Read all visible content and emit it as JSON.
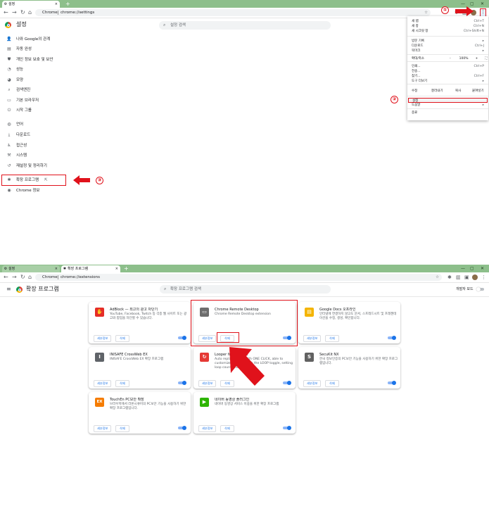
{
  "colors": {
    "tab_strip": "#8dbf8b",
    "accent": "#1a73e8",
    "highlight": "#e0121b"
  },
  "settings_window": {
    "tab_title": "설정",
    "address": {
      "label": "Chrome",
      "url": "chrome://settings"
    },
    "page_title": "설정",
    "search_placeholder": "설정 검색",
    "sidebar": [
      {
        "label": "나와 Google의 관계",
        "icon": "person-icon"
      },
      {
        "label": "자동 완성",
        "icon": "clipboard-icon"
      },
      {
        "label": "개인 정보 보호 및 보안",
        "icon": "shield-icon"
      },
      {
        "label": "성능",
        "icon": "speedometer-icon"
      },
      {
        "label": "모양",
        "icon": "palette-icon"
      },
      {
        "label": "검색엔진",
        "icon": "search-icon"
      },
      {
        "label": "기본 브라우저",
        "icon": "browser-icon"
      },
      {
        "label": "시작 그룹",
        "icon": "power-icon"
      },
      {
        "label": "언어",
        "icon": "globe-icon"
      },
      {
        "label": "다운로드",
        "icon": "download-icon"
      },
      {
        "label": "접근성",
        "icon": "accessibility-icon"
      },
      {
        "label": "시스템",
        "icon": "wrench-icon"
      },
      {
        "label": "재설정 및 정리하기",
        "icon": "reset-icon"
      },
      {
        "label": "확장 프로그램",
        "icon": "puzzle-icon"
      },
      {
        "label": "Chrome 정보",
        "icon": "chrome-icon"
      }
    ],
    "annotations": {
      "step1": "①",
      "step2": "②",
      "step3": "③"
    }
  },
  "menu": {
    "items": [
      {
        "label": "새 탭",
        "shortcut": "Ctrl+T"
      },
      {
        "label": "새 창",
        "shortcut": "Ctrl+N"
      },
      {
        "label": "새 시크릿 창",
        "shortcut": "Ctrl+Shift+N"
      },
      {
        "label": "방문 기록",
        "shortcut": "▸"
      },
      {
        "label": "다운로드",
        "shortcut": "Ctrl+J"
      },
      {
        "label": "북마크",
        "shortcut": "▸"
      },
      {
        "label": "확대/축소",
        "shortcut": ""
      },
      {
        "label": "인쇄...",
        "shortcut": "Ctrl+P"
      },
      {
        "label": "전송...",
        "shortcut": ""
      },
      {
        "label": "찾기...",
        "shortcut": "Ctrl+F"
      },
      {
        "label": "도구 더보기",
        "shortcut": "▸"
      },
      {
        "label": "설정",
        "shortcut": ""
      },
      {
        "label": "도움말",
        "shortcut": "▸"
      },
      {
        "label": "종료",
        "shortcut": ""
      }
    ],
    "zoom": {
      "minus": "-",
      "value": "100%",
      "plus": "+"
    },
    "edit": {
      "label": "수정",
      "cut": "잘라내기",
      "copy": "복사",
      "paste": "붙여넣기"
    }
  },
  "ext_window": {
    "tabs": [
      "설정",
      "확장 프로그램"
    ],
    "address": {
      "label": "Chrome",
      "url": "chrome://extensions"
    },
    "page_title": "확장 프로그램",
    "search_placeholder": "확장 프로그램 검색",
    "dev_mode_label": "개발자 모드",
    "details_label": "세부정보",
    "remove_label": "삭제",
    "cards": [
      {
        "name": "AdBlock — 최고의 광고 차단기",
        "desc": "YouTube, Facebook, Twitch 등 각종 웹 사이트 또는 광고와 팝업을 차단할 수 있습니다.",
        "icon": "adblock-icon",
        "color": "#e52d27",
        "glyph": "✋"
      },
      {
        "name": "Chrome Remote Desktop",
        "desc": "Chrome Remote Desktop extension",
        "icon": "remote-desktop-icon",
        "color": "#6d6d6d",
        "glyph": "▭"
      },
      {
        "name": "Google Docs 오프라인",
        "desc": "인터넷에 연결하지 않고도 문서, 스프레드시트 및 프레젠테이션을 수정, 생성, 확인합니다.",
        "icon": "google-docs-icon",
        "color": "#f4b400",
        "glyph": "▤"
      },
      {
        "name": "INISAFE CrossWeb EX",
        "desc": "INISAFE CrossWeb EX 확장 프로그램",
        "icon": "inisafe-icon",
        "color": "#5f6368",
        "glyph": "I"
      },
      {
        "name": "Looper for YouTube",
        "desc": "Auto replay videos with ONE CLICK, able to customize featured with the LOOP toggle, setting loop count and portion.",
        "icon": "looper-icon",
        "color": "#e53935",
        "glyph": "↻"
      },
      {
        "name": "SecuKit NX",
        "desc": "한국 정보인증의 PC보안 기능을 사용하기 위한 확장 프로그램입니다.",
        "icon": "secukit-icon",
        "color": "#616161",
        "glyph": "S"
      },
      {
        "name": "TouchEn PC보안 확장",
        "desc": "브라우저에서 라온시큐어의 PC보안 기능을 사용하기 위한 확장 프로그램입니다.",
        "icon": "touchen-icon",
        "color": "#f57c00",
        "glyph": "EX"
      },
      {
        "name": "네이버 동영상 플러그인",
        "desc": "네이버 동영상 서비스 이용을 위한 확장 프로그램",
        "icon": "naver-video-icon",
        "color": "#2db400",
        "glyph": "▶"
      }
    ]
  }
}
